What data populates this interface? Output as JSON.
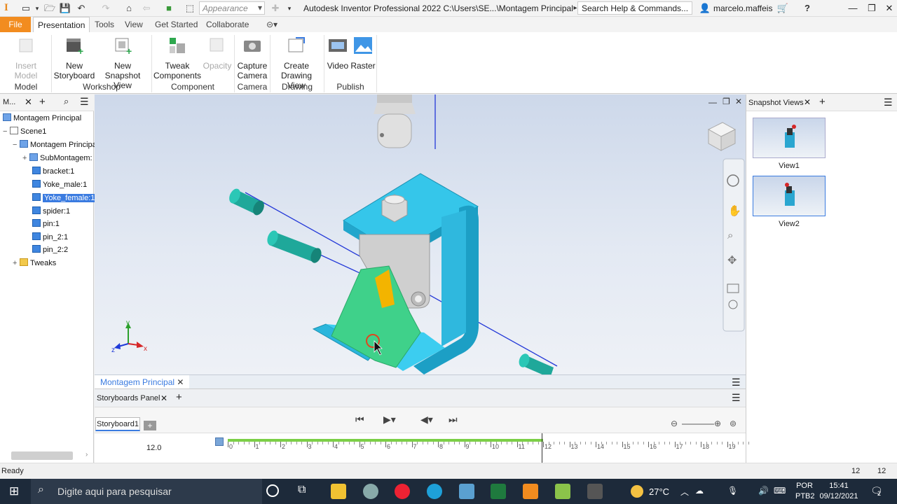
{
  "titlebar": {
    "appearance_placeholder": "Appearance",
    "window_title": "Autodesk Inventor Professional 2022   C:\\Users\\SE...\\Montagem Principal",
    "search_placeholder": "Search Help & Commands...",
    "user_name": "marcelo.maffeis",
    "help_icon": "?"
  },
  "menu": {
    "tabs": [
      "File",
      "Presentation",
      "Tools",
      "View",
      "Get Started",
      "Collaborate"
    ]
  },
  "ribbon": {
    "buttons": {
      "insert_model": "Insert Model",
      "new_storyboard_1": "New",
      "new_storyboard_2": "Storyboard",
      "new_snapshot_1": "New",
      "new_snapshot_2": "Snapshot View",
      "tweak_1": "Tweak",
      "tweak_2": "Components",
      "opacity": "Opacity",
      "capture_1": "Capture",
      "capture_2": "Camera",
      "create_dv_1": "Create",
      "create_dv_2": "Drawing View",
      "video": "Video",
      "raster": "Raster"
    },
    "groups": [
      "Model",
      "Workshop",
      "Component",
      "Camera",
      "Drawing",
      "Publish"
    ]
  },
  "browser": {
    "header_label": "M...",
    "items": [
      {
        "label": "Montagem Principal"
      },
      {
        "label": "Scene1"
      },
      {
        "label": "Montagem Principa"
      },
      {
        "label": "SubMontagem:"
      },
      {
        "label": "bracket:1"
      },
      {
        "label": "Yoke_male:1"
      },
      {
        "label": "Yoke_female:1"
      },
      {
        "label": "spider:1"
      },
      {
        "label": "pin:1"
      },
      {
        "label": "pin_2:1"
      },
      {
        "label": "pin_2:2"
      },
      {
        "label": "Tweaks"
      }
    ]
  },
  "snapshots": {
    "title": "Snapshot Views",
    "views": [
      {
        "label": "View1"
      },
      {
        "label": "View2"
      }
    ]
  },
  "bottom": {
    "doc_tab": "Montagem Principal",
    "panel_tab": "Storyboards Panel",
    "storyboard_tab": "Storyboard1",
    "time_value": "12.0",
    "ticks": [
      "0",
      "1",
      "2",
      "3",
      "4",
      "5",
      "6",
      "7",
      "8",
      "9",
      "10",
      "11",
      "12",
      "13",
      "14",
      "15",
      "16",
      "17",
      "18",
      "19"
    ]
  },
  "status": {
    "text": "Ready",
    "count_a": "12",
    "count_b": "12"
  },
  "taskbar": {
    "search_placeholder": "Digite aqui para pesquisar",
    "weather": "27°C",
    "lang_1": "POR",
    "lang_2": "PTB2",
    "time": "15:41",
    "date": "09/12/2021",
    "notifications": "2"
  },
  "colors": {
    "accent_orange": "#f28c1f",
    "selection_blue": "#3a7be0",
    "part_cyan": "#2ec4e8",
    "part_green": "#3dd08a",
    "pin_teal": "#1fa89a",
    "timeline_green": "#7ccf47"
  }
}
